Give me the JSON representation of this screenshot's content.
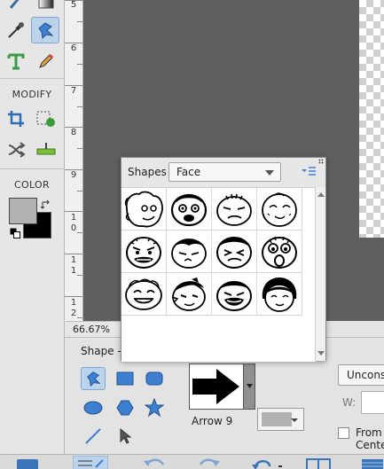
{
  "toolbox": {
    "modify_label": "MODIFY",
    "color_label": "COLOR",
    "foreground_color": "#b2b2b2",
    "background_color": "#000000"
  },
  "ruler": {
    "numbers": [
      "5",
      "6",
      "7",
      "8",
      "9",
      "10",
      "11",
      "12"
    ]
  },
  "zoom": {
    "value": "66.67%"
  },
  "options": {
    "shape_label": "Shape -",
    "custom_shape_name": "Arrow 9",
    "constrain_value": "Unconstrained",
    "w_label": "W:",
    "from_label": "From Center",
    "shape_color": "#b2b2b2"
  },
  "shape_picker": {
    "label": "Shapes",
    "category": "Face",
    "faces": [
      "face-1",
      "face-2",
      "face-3",
      "face-4",
      "face-5",
      "face-6",
      "face-7",
      "face-8",
      "face-9",
      "face-10",
      "face-11",
      "face-12"
    ]
  }
}
